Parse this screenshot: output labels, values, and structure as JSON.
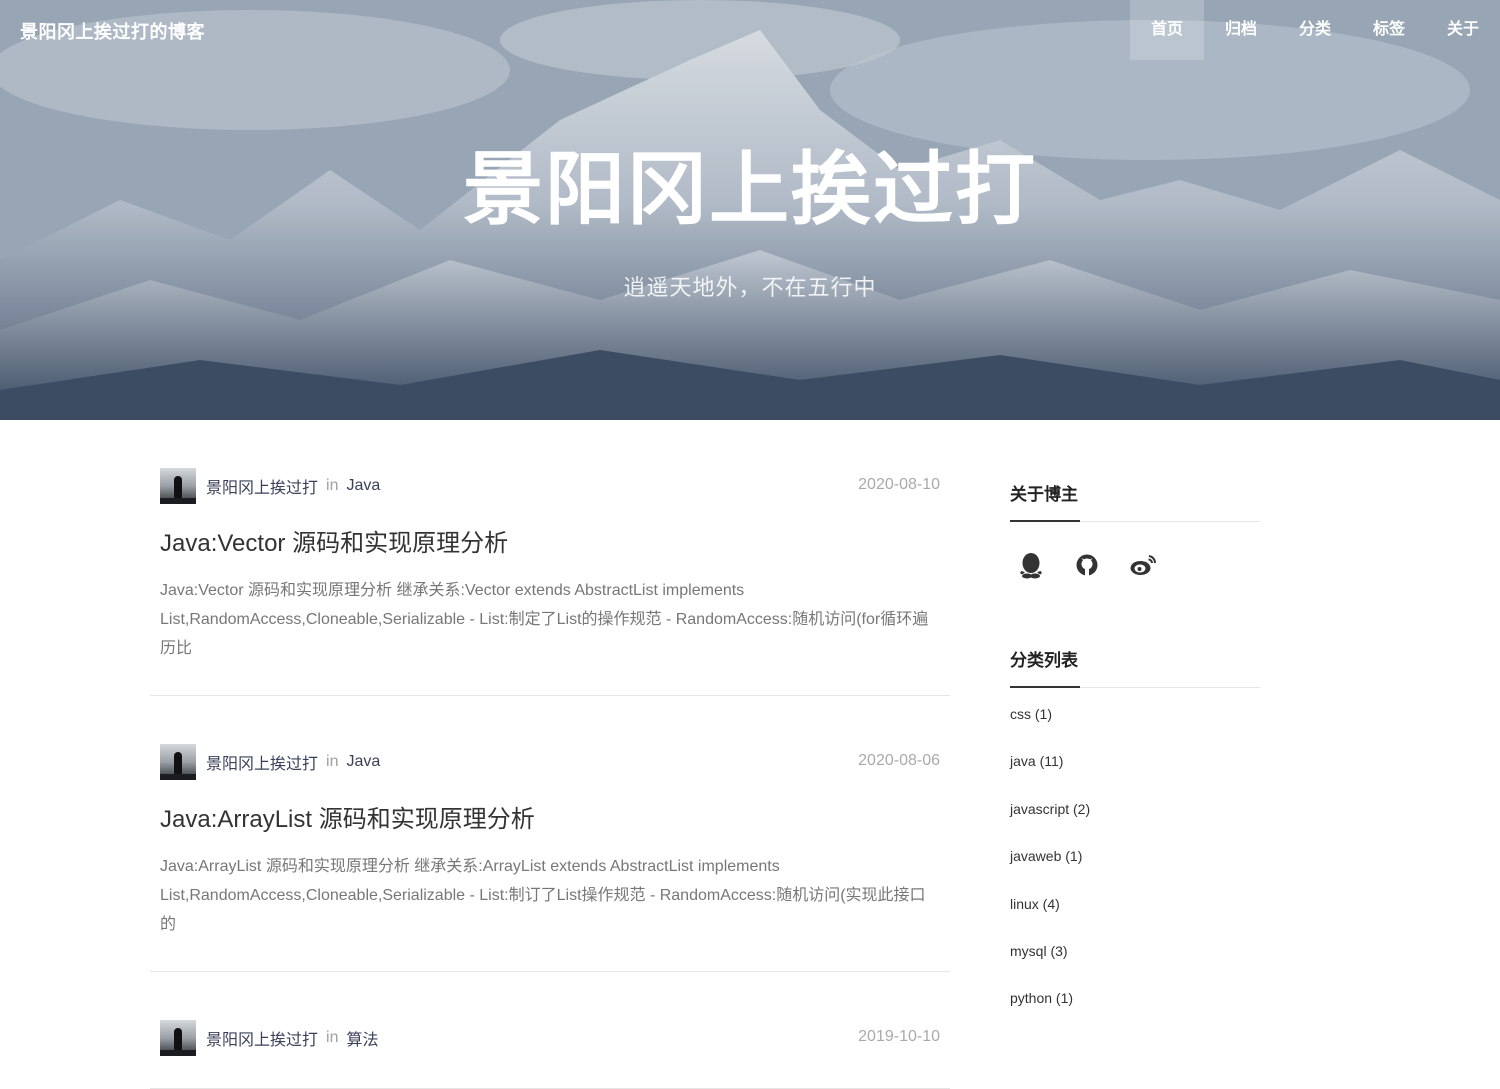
{
  "brand": "景阳冈上挨过打的博客",
  "nav": [
    {
      "label": "首页",
      "active": true
    },
    {
      "label": "归档",
      "active": false
    },
    {
      "label": "分类",
      "active": false
    },
    {
      "label": "标签",
      "active": false
    },
    {
      "label": "关于",
      "active": false
    }
  ],
  "hero": {
    "title": "景阳冈上挨过打",
    "subtitle": "逍遥天地外，不在五行中"
  },
  "posts": [
    {
      "author": "景阳冈上挨过打",
      "in": "in",
      "category": "Java",
      "date": "2020-08-10",
      "title": "Java:Vector 源码和实现原理分析",
      "summary": "Java:Vector 源码和实现原理分析 继承关系:Vector extends AbstractList implements List,RandomAccess,Cloneable,Serializable - List:制定了List的操作规范 - RandomAccess:随机访问(for循环遍历比"
    },
    {
      "author": "景阳冈上挨过打",
      "in": "in",
      "category": "Java",
      "date": "2020-08-06",
      "title": "Java:ArrayList 源码和实现原理分析",
      "summary": "Java:ArrayList 源码和实现原理分析 继承关系:ArrayList extends AbstractList implements List,RandomAccess,Cloneable,Serializable - List:制订了List操作规范 - RandomAccess:随机访问(实现此接口的"
    },
    {
      "author": "景阳冈上挨过打",
      "in": "in",
      "category": "算法",
      "date": "2019-10-10",
      "title": "",
      "summary": ""
    }
  ],
  "sidebar": {
    "about_title": "关于博主",
    "social_icons": [
      "qq-icon",
      "github-icon",
      "weibo-icon"
    ],
    "categories_title": "分类列表",
    "categories": [
      "css (1)",
      "java (11)",
      "javascript (2)",
      "javaweb (1)",
      "linux (4)",
      "mysql (3)",
      "python (1)"
    ]
  }
}
